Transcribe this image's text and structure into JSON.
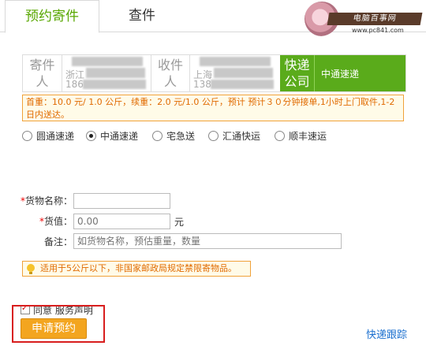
{
  "tabs": {
    "active": "预约寄件",
    "inactive": "查件"
  },
  "watermark": {
    "title": "电脑百事网",
    "url": "www.pc841.com"
  },
  "sender": {
    "label_line1": "寄件",
    "label_line2": "人",
    "city": "浙江",
    "phone_prefix": "186"
  },
  "receiver": {
    "label_line1": "收件",
    "label_line2": "人",
    "city": "上海",
    "phone_prefix": "138"
  },
  "express": {
    "label_line1": "快递",
    "label_line2": "公司",
    "value": "中通速递",
    "accent": "#5aab1b"
  },
  "fee": {
    "text": "首重：10.0 元/ 1.0 公斤，续重：2.0 元/1.0 公斤，预计 预计３０分钟接单,1小时上门取件,1-2 日内送达。"
  },
  "carriers": [
    {
      "label": "圆通速递",
      "checked": false
    },
    {
      "label": "中通速递",
      "checked": true
    },
    {
      "label": "宅急送",
      "checked": false
    },
    {
      "label": "汇通快运",
      "checked": false
    },
    {
      "label": "顺丰速运",
      "checked": false
    }
  ],
  "form": {
    "required_mark": "*",
    "goods_name_label": "货物名称：",
    "goods_name_value": "",
    "value_label": "货值：",
    "value_placeholder": "0.00",
    "value_unit": "元",
    "note_label": "备注：",
    "note_placeholder": "如货物名称，预估重量，数量"
  },
  "tip": {
    "text": "适用于5公斤以下，非国家邮政局规定禁限寄物品。"
  },
  "agree": {
    "text": "同意 服务声明",
    "checked": true
  },
  "submit": {
    "label": "申请预约"
  },
  "track_link": {
    "label": "快递跟踪"
  }
}
